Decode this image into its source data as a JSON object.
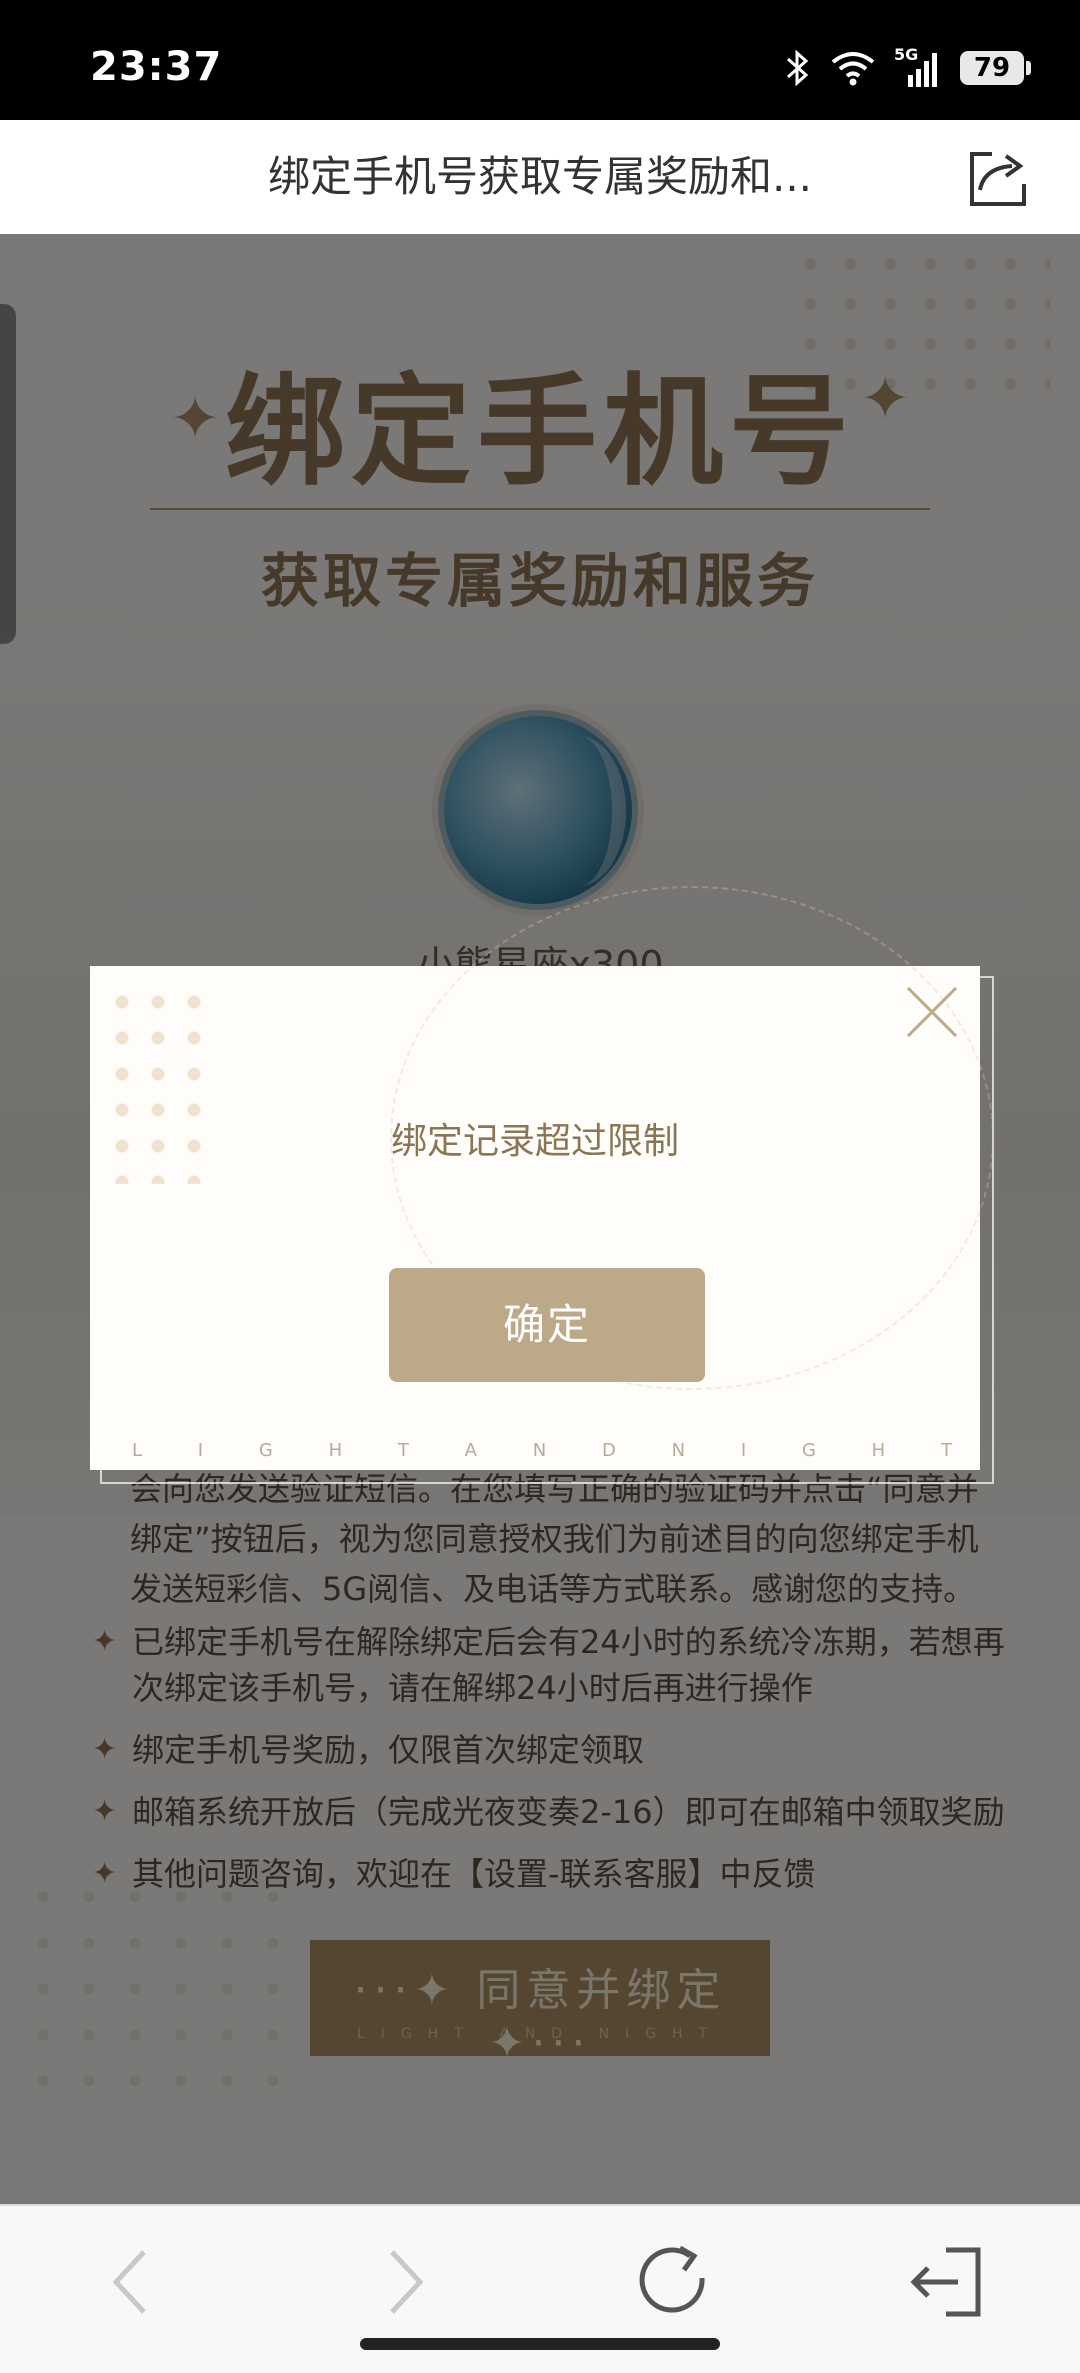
{
  "status_bar": {
    "time": "23:37",
    "network": "5G",
    "battery": "79"
  },
  "nav": {
    "title": "绑定手机号获取专属奖励和...",
    "share_icon": "share-icon"
  },
  "hero": {
    "title": "绑定手机号",
    "subtitle": "获取专属奖励和服务"
  },
  "reward": {
    "label": "小熊星座x300"
  },
  "partial_text": "会向您发送验证短信。在您填写正确的验证码并点击“同意并绑定”按钮后，视为您同意授权我们为前述目的向您绑定手机发送短彩信、5G阅信、及电话等方式联系。感谢您的支持。",
  "notes": [
    "已绑定手机号在解除绑定后会有24小时的系统冷冻期，若想再次绑定该手机号，请在解绑24小时后再进行操作",
    "绑定手机号奖励，仅限首次绑定领取",
    "邮箱系统开放后（完成光夜变奏2-16）即可在邮箱中领取奖励",
    "其他问题咨询，欢迎在【设置-联系客服】中反馈"
  ],
  "agree_button": {
    "label": "···✦ 同意并绑定 ✦···",
    "sub": "LIGHT AND NIGHT"
  },
  "dialog": {
    "message": "绑定记录超过限制",
    "confirm_label": "确定",
    "footer_letters": [
      "L",
      "I",
      "G",
      "H",
      "T",
      "A",
      "N",
      "D",
      "N",
      "I",
      "G",
      "H",
      "T"
    ]
  },
  "toolbar": {
    "back": "back-icon",
    "forward": "forward-icon",
    "refresh": "refresh-icon",
    "exit": "exit-icon"
  },
  "colors": {
    "accent": "#bca987",
    "gold_text": "#8a7554"
  }
}
